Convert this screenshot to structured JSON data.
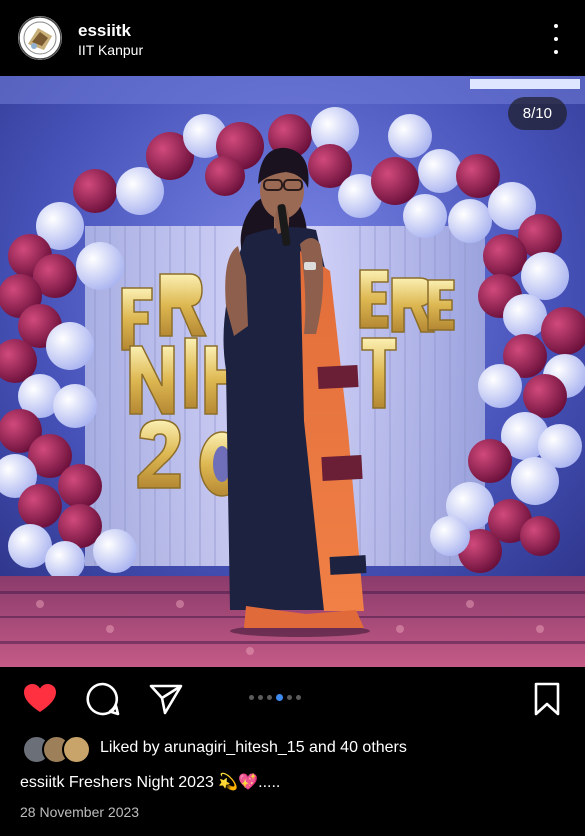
{
  "post": {
    "username": "essiitk",
    "location": "IIT Kanpur",
    "slide_counter": "8/10",
    "likes_text": "Liked by arunagiri_hitesh_15 and 40 others",
    "caption": "essiitk Freshers Night 2023 💫💖.....",
    "date": "28 November 2023"
  },
  "carousel": {
    "total": 6,
    "active": 3
  },
  "icons": {
    "avatar": "profile-logo",
    "more": "more-vertical-icon",
    "like": "heart-filled-icon",
    "comment": "comment-icon",
    "share": "send-icon",
    "save": "bookmark-icon"
  },
  "colors": {
    "like": "#ff3040",
    "active_dot": "#3d8bf0"
  }
}
